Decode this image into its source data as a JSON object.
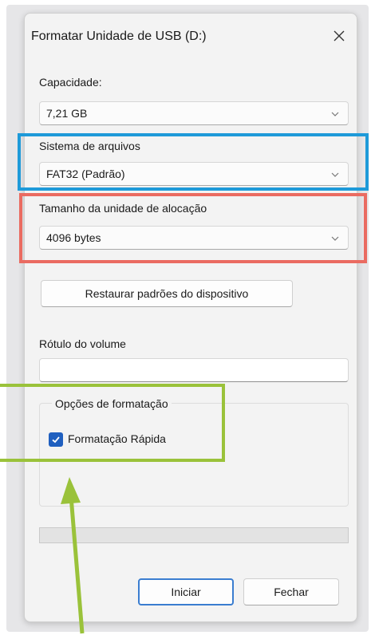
{
  "window": {
    "title": "Formatar Unidade de USB (D:)",
    "close_icon": "close-icon"
  },
  "capacity": {
    "label": "Capacidade:",
    "value": "7,21 GB"
  },
  "file_system": {
    "label": "Sistema de arquivos",
    "value": "FAT32 (Padrão)"
  },
  "allocation": {
    "label": "Tamanho da unidade de alocação",
    "value": "4096 bytes"
  },
  "restore_button": "Restaurar padrões do dispositivo",
  "volume_label": {
    "label": "Rótulo do volume",
    "value": ""
  },
  "format_options": {
    "group_label": "Opções de formatação",
    "quick_format": {
      "label": "Formatação Rápida",
      "checked": true
    }
  },
  "progress": {
    "value": 0
  },
  "buttons": {
    "start": "Iniciar",
    "close": "Fechar"
  },
  "colors": {
    "highlight_file_system": "#1e9ad9",
    "highlight_allocation": "#ea6b61",
    "highlight_format_options": "#9ac23a",
    "checkbox_accent": "#1f5fbf"
  }
}
